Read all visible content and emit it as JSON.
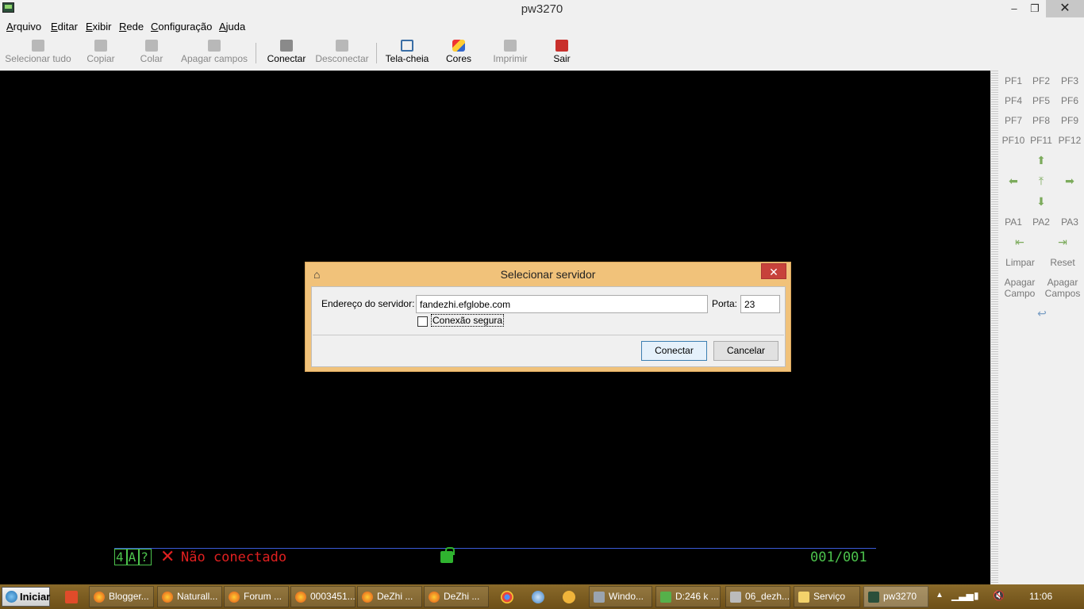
{
  "window": {
    "title": "pw3270",
    "min": "–",
    "max": "❐",
    "close": "✕"
  },
  "menu": [
    "Arquivo",
    "Editar",
    "Exibir",
    "Rede",
    "Configuração",
    "Ajuda"
  ],
  "toolbar": {
    "select_all": "Selecionar tudo",
    "copy": "Copiar",
    "paste": "Colar",
    "erase_fields": "Apagar campos",
    "connect": "Conectar",
    "disconnect": "Desconectar",
    "fullscreen": "Tela-cheia",
    "colors": "Cores",
    "print": "Imprimir",
    "exit": "Sair"
  },
  "keypad": {
    "pf": [
      "PF1",
      "PF2",
      "PF3",
      "PF4",
      "PF5",
      "PF6",
      "PF7",
      "PF8",
      "PF9",
      "PF10",
      "PF11",
      "PF12"
    ],
    "pa": [
      "PA1",
      "PA2",
      "PA3"
    ],
    "clear": "Limpar",
    "reset": "Reset",
    "erase_field": [
      "Apagar",
      "Campo"
    ],
    "erase_fields": [
      "Apagar",
      "Campos"
    ]
  },
  "dialog": {
    "title": "Selecionar servidor",
    "server_label": "Endereço do servidor:",
    "server_value": "fandezhi.efglobe.com",
    "port_label": "Porta:",
    "port_value": "23",
    "secure_label": "Conexão segura",
    "secure_checked": false,
    "connect_button": "Conectar",
    "cancel_button": "Cancelar",
    "close": "✕"
  },
  "oia": {
    "indicator": [
      "4",
      "A",
      "?"
    ],
    "status_icon": "✕",
    "status": "Não conectado",
    "cursor_pos": "001/001",
    "colors": {
      "green": "#4cc24c",
      "red": "#e02020"
    }
  },
  "taskbar": {
    "start": "Iniciar",
    "tasks": [
      "Blogger...",
      "Naturall...",
      "Forum ...",
      "0003451...",
      "DeZhi ...",
      "DeZhi ...",
      "Windo...",
      "D:246 k ...",
      "06_dezh...",
      "Serviço",
      "pw3270"
    ],
    "clock": "11:06"
  }
}
